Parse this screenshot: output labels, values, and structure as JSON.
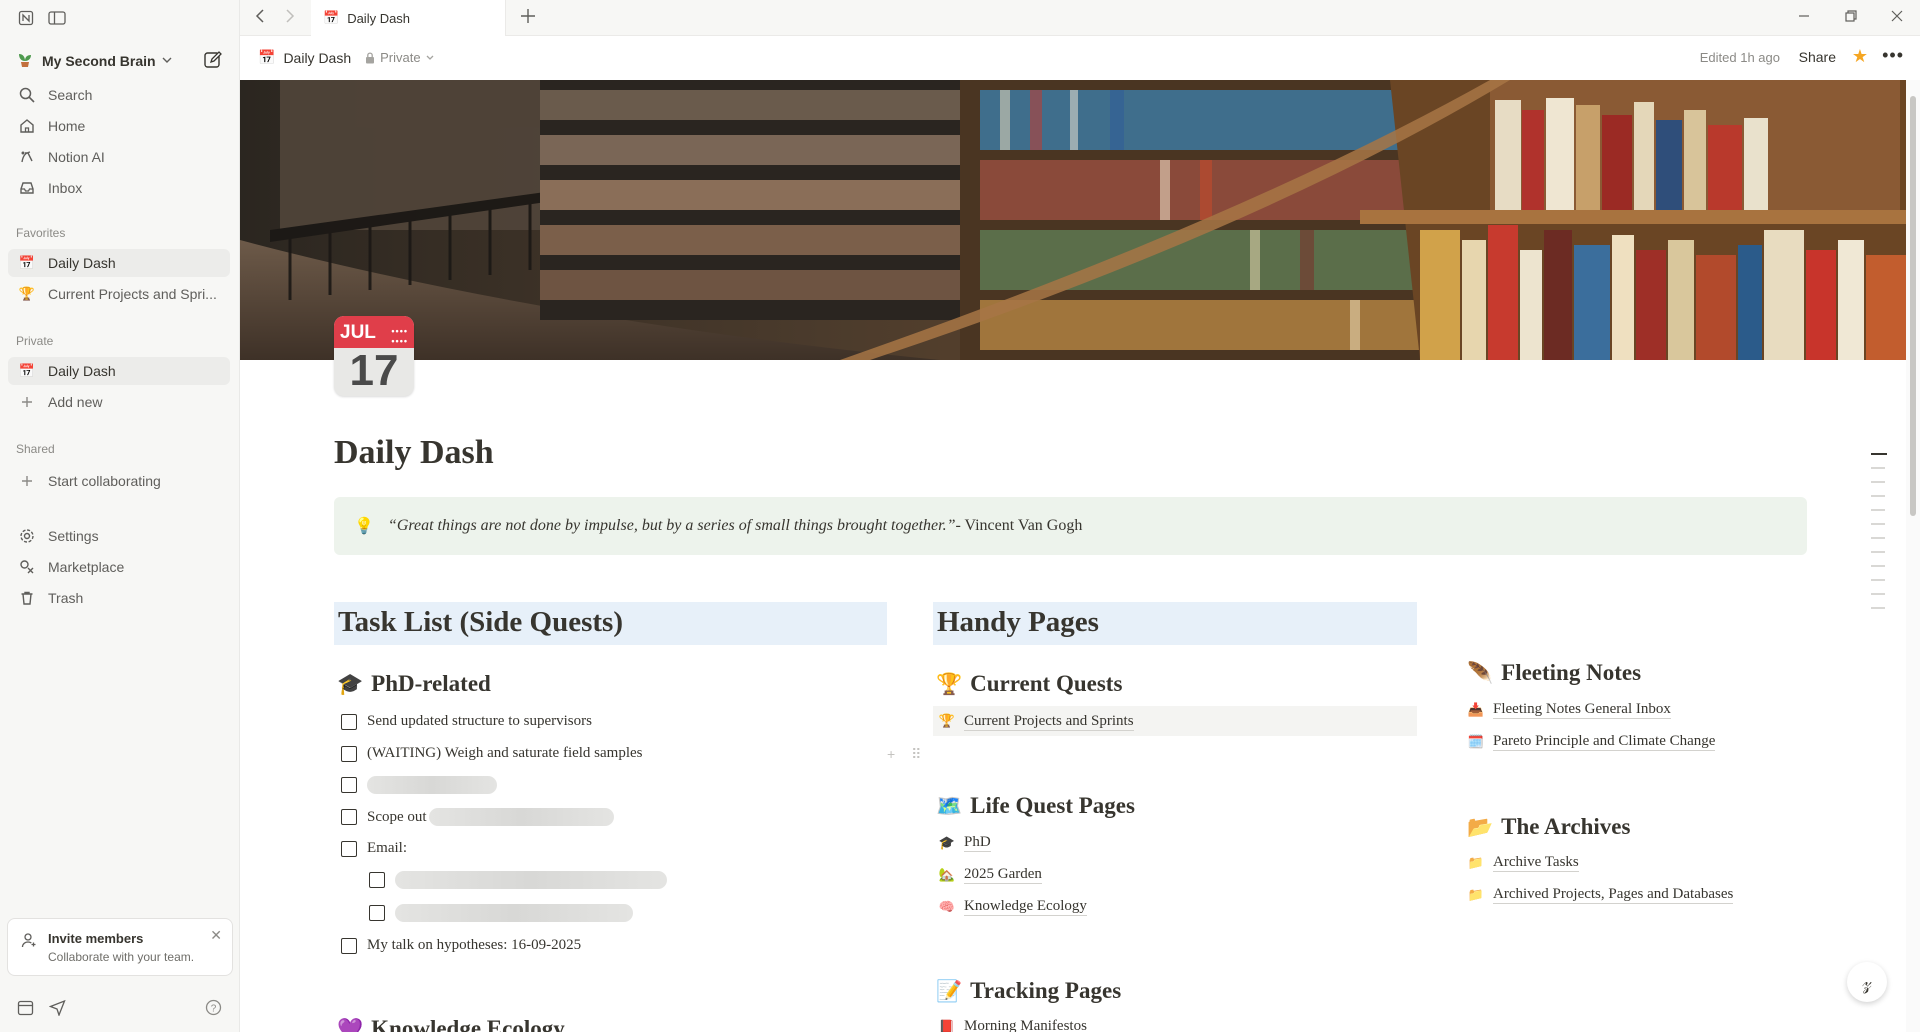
{
  "sidebar": {
    "workspace": "My Second Brain",
    "nav": [
      {
        "label": "Search"
      },
      {
        "label": "Home"
      },
      {
        "label": "Notion AI"
      },
      {
        "label": "Inbox"
      }
    ],
    "favorites_label": "Favorites",
    "favorites": [
      {
        "emoji": "📅",
        "label": "Daily Dash"
      },
      {
        "emoji": "🏆",
        "label": "Current Projects and Spri..."
      }
    ],
    "private_label": "Private",
    "private": [
      {
        "emoji": "📅",
        "label": "Daily Dash"
      },
      {
        "label": "Add new"
      }
    ],
    "shared_label": "Shared",
    "shared": [
      {
        "label": "Start collaborating"
      }
    ],
    "bottom": [
      {
        "label": "Settings"
      },
      {
        "label": "Marketplace"
      },
      {
        "label": "Trash"
      }
    ],
    "invite": {
      "title": "Invite members",
      "subtitle": "Collaborate with your team."
    }
  },
  "tab": {
    "emoji": "📅",
    "title": "Daily Dash"
  },
  "header": {
    "emoji": "📅",
    "title": "Daily Dash",
    "privacy": "Private",
    "edited": "Edited 1h ago",
    "share": "Share"
  },
  "page": {
    "icon_month": "JUL",
    "icon_day": "17",
    "title": "Daily Dash",
    "callout": {
      "emoji": "💡",
      "quote": "“Great things are not done by impulse, but by a series of small things brought together.”",
      "author": " - Vincent Van Gogh"
    }
  },
  "tasks": {
    "heading": "Task List (Side Quests)",
    "phd": {
      "emoji": "🎓",
      "heading": "PhD-related",
      "items": [
        "Send updated structure to supervisors",
        "(WAITING) Weigh and saturate field samples",
        "",
        "Scope out",
        "Email:",
        "",
        "",
        "My talk on hypotheses:  16-09-2025"
      ]
    },
    "next_heading": {
      "emoji": "💜",
      "label": "Knowledge Ecology"
    }
  },
  "handy": {
    "heading": "Handy Pages",
    "current_quests": {
      "emoji": "🏆",
      "heading": "Current Quests",
      "links": [
        {
          "emoji": "🏆",
          "label": "Current Projects and Sprints"
        }
      ]
    },
    "life_quests": {
      "emoji": "🗺️",
      "heading": "Life Quest Pages",
      "links": [
        {
          "emoji": "🎓",
          "label": "PhD"
        },
        {
          "emoji": "🏡",
          "label": "2025 Garden"
        },
        {
          "emoji": "🧠",
          "label": "Knowledge Ecology"
        }
      ]
    },
    "tracking": {
      "emoji": "📝",
      "heading": "Tracking Pages",
      "links": [
        {
          "emoji": "📕",
          "label": "Morning Manifestos"
        }
      ]
    }
  },
  "right": {
    "fleeting": {
      "emoji": "🪶",
      "heading": "Fleeting Notes",
      "links": [
        {
          "emoji": "📥",
          "label": "Fleeting Notes General Inbox"
        },
        {
          "emoji": "🗓️",
          "label": "Pareto Principle and Climate Change"
        }
      ]
    },
    "archives": {
      "emoji": "📂",
      "heading": "The Archives",
      "links": [
        {
          "emoji": "📁",
          "label": "Archive Tasks"
        },
        {
          "emoji": "📁",
          "label": "Archived Projects, Pages and Databases"
        }
      ]
    }
  },
  "colors": {
    "sidebar_bg": "#f7f7f5",
    "callout_bg": "#edf3ec",
    "heading_bg": "#e7f0f9",
    "accent_red": "#e03e4a",
    "star": "#f5a623"
  }
}
